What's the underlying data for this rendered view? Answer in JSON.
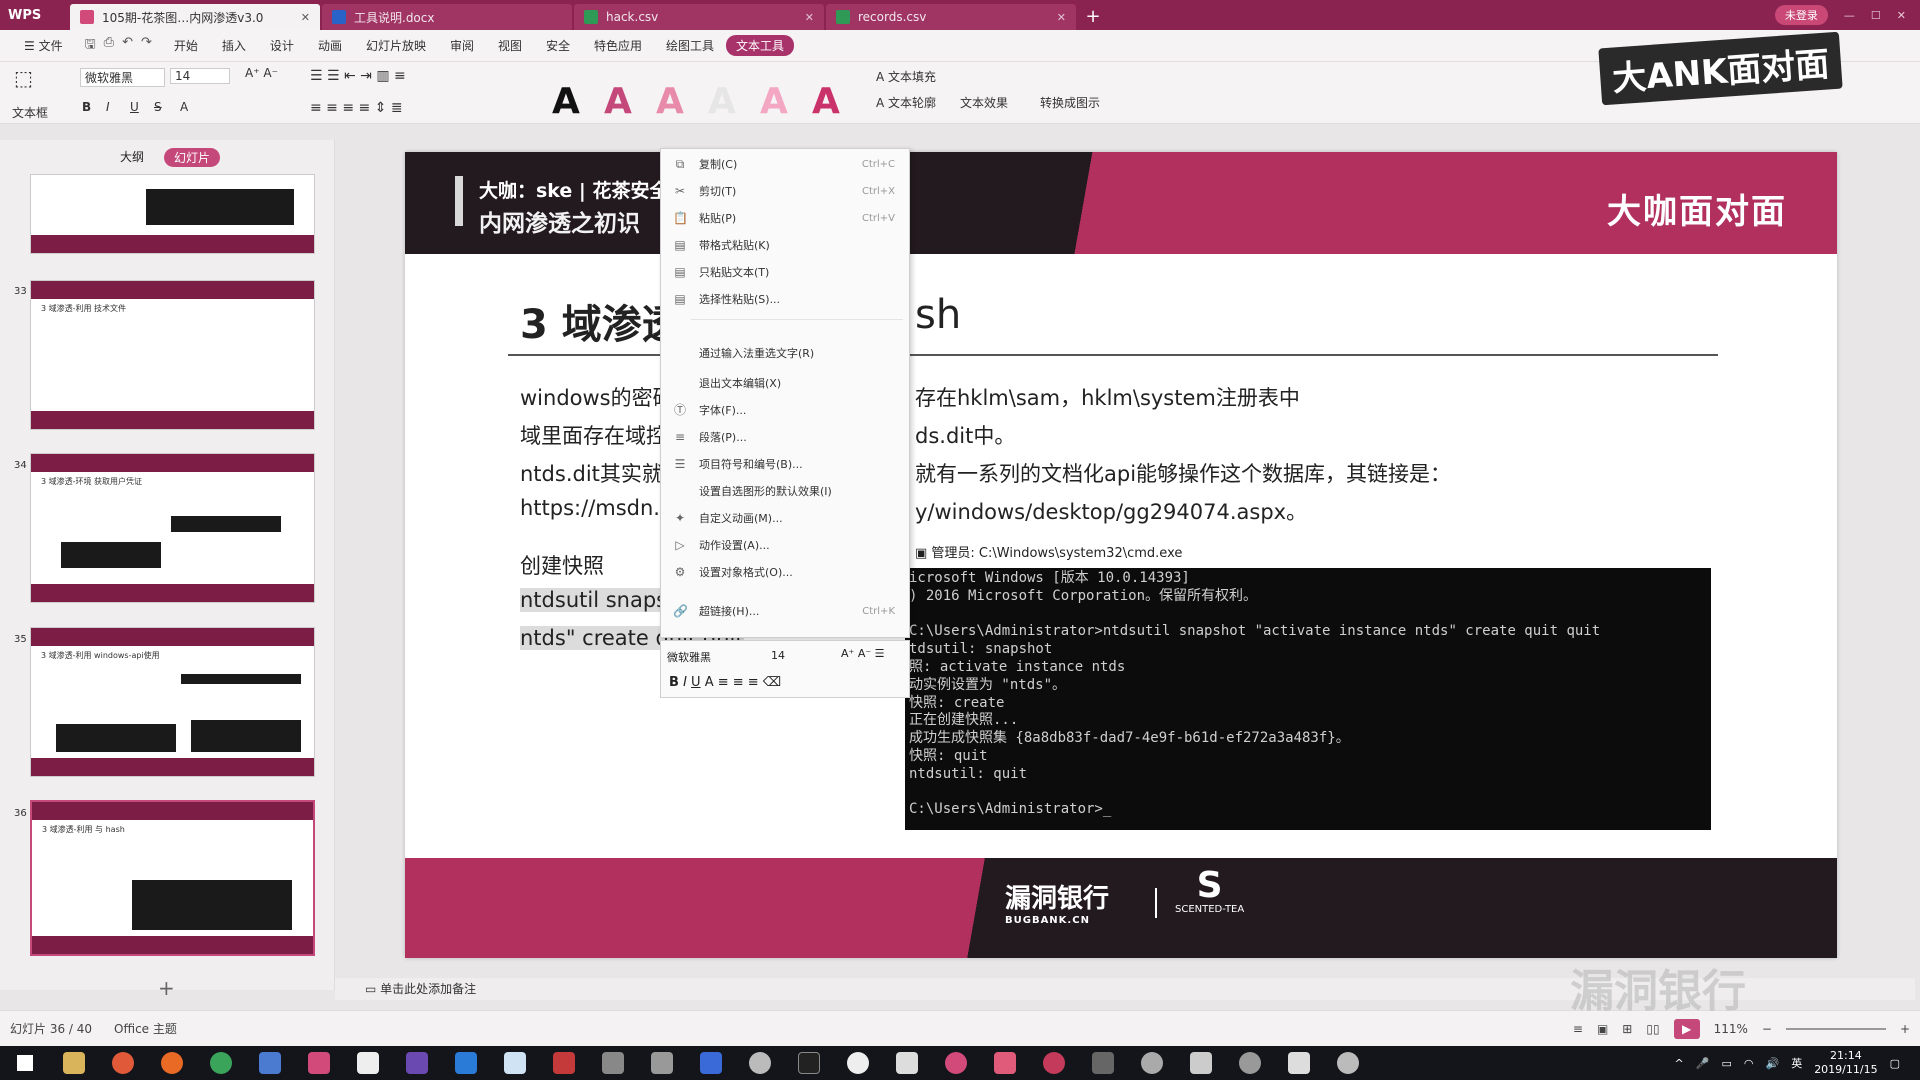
{
  "app": {
    "name": "WPS",
    "tabs": [
      {
        "label": "105期-花茶图…内网渗透v3.0",
        "active": true,
        "color": "#d24a7a"
      },
      {
        "label": "工具说明.docx",
        "active": false,
        "color": "#2a63c8"
      },
      {
        "label": "hack.csv",
        "active": false,
        "color": "#2f9a55"
      },
      {
        "label": "records.csv",
        "active": false,
        "color": "#2f9a55"
      }
    ],
    "login_label": "未登录"
  },
  "menu": {
    "file": "文件",
    "items": [
      "开始",
      "插入",
      "设计",
      "动画",
      "幻灯片放映",
      "审阅",
      "视图",
      "安全",
      "特色应用",
      "绘图工具",
      "文本工具"
    ],
    "active": "文本工具"
  },
  "ribbon": {
    "textbox": "文本框",
    "font": "微软雅黑",
    "size": "14",
    "text_fill": "文本填充",
    "text_outline": "文本轮廓",
    "text_effect": "文本效果",
    "convert": "转换成图示"
  },
  "left_panel": {
    "tab_outline": "大纲",
    "tab_slides": "幻灯片",
    "thumbs": [
      {
        "num": "33",
        "title": "3 域渗透-利用 技术文件"
      },
      {
        "num": "34",
        "title": "3 域渗透-环境 获取用户凭证"
      },
      {
        "num": "35",
        "title": "3 域渗透-利用 windows-api使用"
      },
      {
        "num": "36",
        "title": "3 域渗透-利用 与 hash"
      }
    ]
  },
  "slide": {
    "header_line1": "大咖：ske | 花茶安全团",
    "header_line2": "内网渗透之初识",
    "header_brand": "大咖面对面",
    "title_left": "3 域渗透",
    "title_right": "sh",
    "lines": [
      {
        "left": "windows的密码",
        "right": "存在hklm\\sam，hklm\\system注册表中"
      },
      {
        "left": "域里面存在域控",
        "right": "ds.dit中。"
      },
      {
        "left": "ntds.dit其实就是",
        "right": "就有一系列的文档化api能够操作这个数据库，其链接是："
      },
      {
        "left": "https://msdn.m",
        "right": "y/windows/desktop/gg294074.aspx。"
      }
    ],
    "snapshot_label": "创建快照",
    "cmd_line1": "ntdsutil snapsh",
    "cmd_line2": "ntds\" create quit quit",
    "cmd_window_title": "管理员: C:\\Windows\\system32\\cmd.exe",
    "cmd_output": "icrosoft Windows [版本 10.0.14393]\n) 2016 Microsoft Corporation。保留所有权利。\n\nC:\\Users\\Administrator>ntdsutil snapshot \"activate instance ntds\" create quit quit\ntdsutil: snapshot\n照: activate instance ntds\n动实例设置为 \"ntds\"。\n快照: create\n正在创建快照...\n成功生成快照集 {8a8db83f-dad7-4e9f-b61d-ef272a3a483f}。\n快照: quit\nntdsutil: quit\n\nC:\\Users\\Administrator>_",
    "footer_logo1": "漏洞银行",
    "footer_logo1_sub": "BUGBANK.CN",
    "footer_logo2": "SCENTED-TEA"
  },
  "context_menu": {
    "items": [
      {
        "icon": "copy-icon",
        "label": "复制(C)",
        "shortcut": "Ctrl+C"
      },
      {
        "icon": "cut-icon",
        "label": "剪切(T)",
        "shortcut": "Ctrl+X"
      },
      {
        "icon": "paste-icon",
        "label": "粘贴(P)",
        "shortcut": "Ctrl+V"
      },
      {
        "icon": "paste-format-icon",
        "label": "带格式粘贴(K)",
        "shortcut": ""
      },
      {
        "icon": "paste-text-icon",
        "label": "只粘贴文本(T)",
        "shortcut": ""
      },
      {
        "icon": "paste-special-icon",
        "label": "选择性粘贴(S)...",
        "shortcut": ""
      },
      {
        "icon": "",
        "label": "通过输入法重选文字(R)",
        "shortcut": ""
      },
      {
        "icon": "",
        "label": "退出文本编辑(X)",
        "shortcut": ""
      },
      {
        "icon": "font-icon",
        "label": "字体(F)...",
        "shortcut": ""
      },
      {
        "icon": "paragraph-icon",
        "label": "段落(P)...",
        "shortcut": ""
      },
      {
        "icon": "bullets-icon",
        "label": "项目符号和编号(B)...",
        "shortcut": ""
      },
      {
        "icon": "",
        "label": "设置自选图形的默认效果(I)",
        "shortcut": ""
      },
      {
        "icon": "animation-icon",
        "label": "自定义动画(M)...",
        "shortcut": ""
      },
      {
        "icon": "action-icon",
        "label": "动作设置(A)...",
        "shortcut": ""
      },
      {
        "icon": "object-format-icon",
        "label": "设置对象格式(O)...",
        "shortcut": ""
      },
      {
        "icon": "hyperlink-icon",
        "label": "超链接(H)...",
        "shortcut": "Ctrl+K"
      }
    ],
    "mini_font": "微软雅黑",
    "mini_size": "14"
  },
  "notes_placeholder": "单击此处添加备注",
  "status": {
    "slide_count": "幻灯片 36 / 40",
    "theme": "Office 主题",
    "zoom": "111%"
  },
  "taskbar": {
    "time": "21:14",
    "date": "2019/11/15",
    "ime": "英"
  },
  "watermark": "漏洞银行",
  "corner_logo": "大ANK面对面"
}
